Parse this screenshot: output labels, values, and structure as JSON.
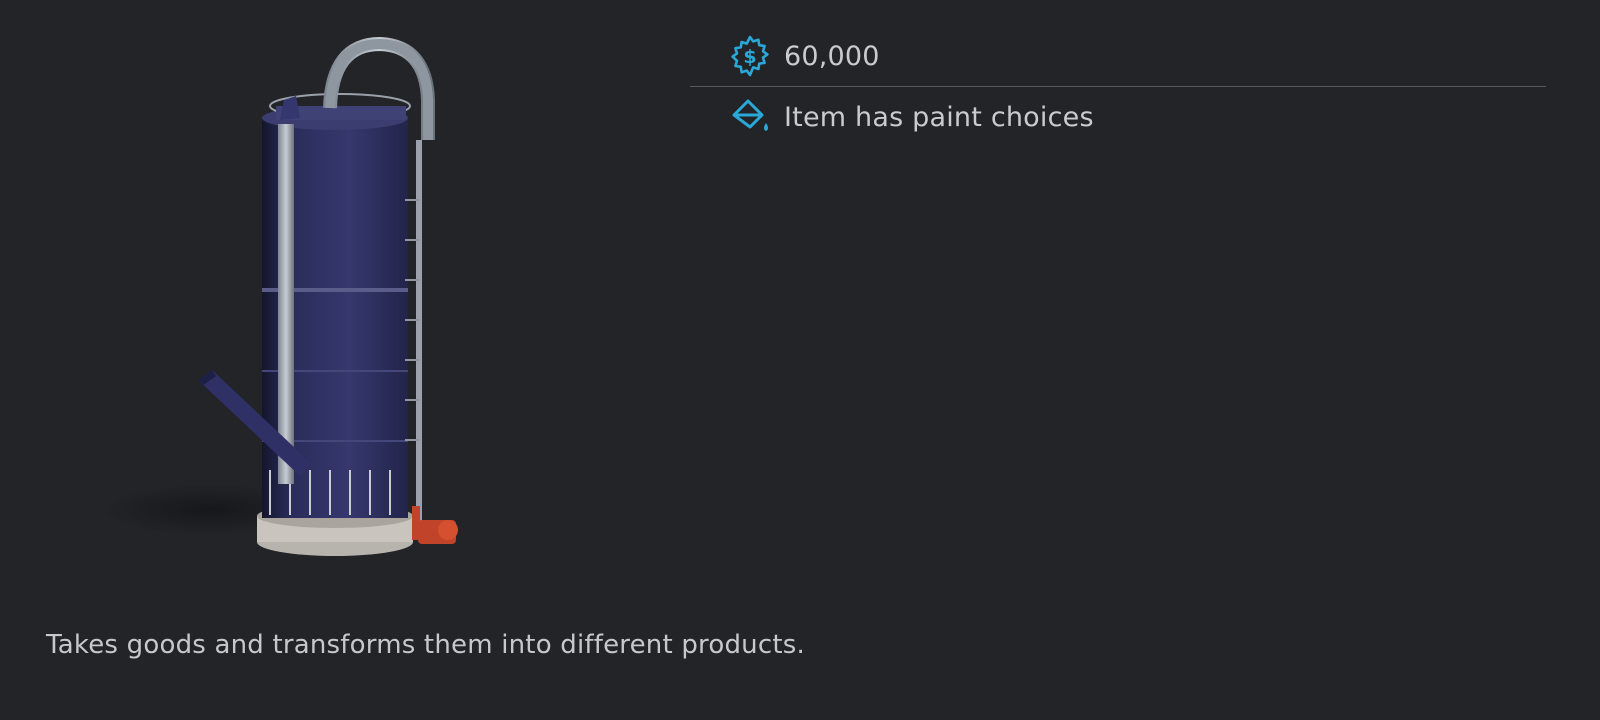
{
  "item": {
    "image_name": "production-silo",
    "price": "60,000",
    "price_icon": "dollar-gear-icon",
    "paint_text": "Item has paint choices",
    "paint_icon": "paint-bucket-icon",
    "description": "Takes goods and transforms them into different products."
  },
  "colors": {
    "background": "#222428",
    "accent": "#2aa8d8",
    "text": "#c9cbce",
    "divider": "#55585d"
  }
}
